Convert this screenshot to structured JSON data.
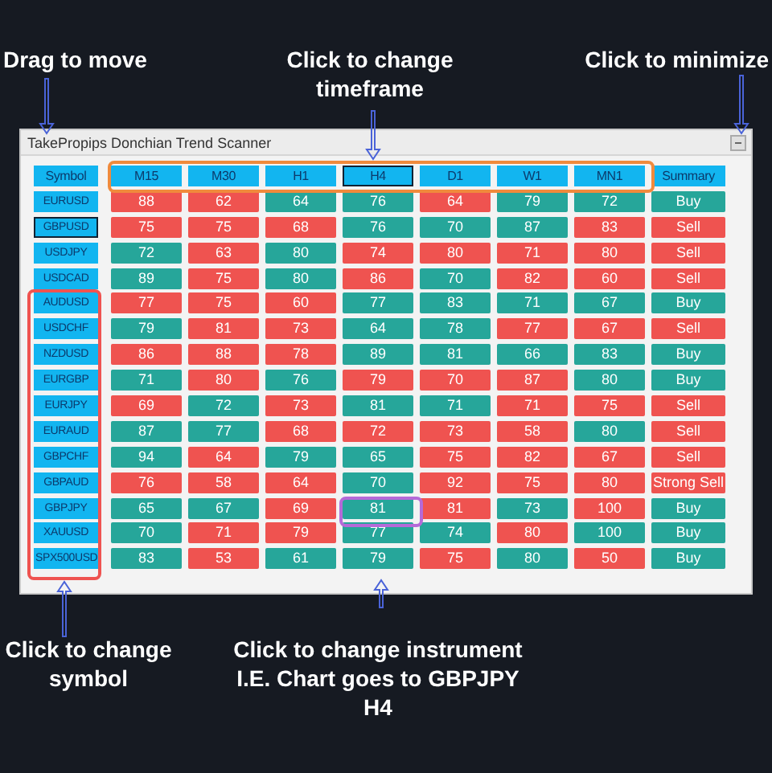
{
  "annotations": {
    "top": [
      {
        "text": "Drag to move"
      },
      {
        "text": "Click to change timeframe"
      },
      {
        "text": "Click to minimize"
      }
    ],
    "bottom": [
      {
        "text": "Click to change symbol"
      },
      {
        "text": "Click to change instrument I.E. Chart goes to GBPJPY H4"
      }
    ]
  },
  "window": {
    "title": "TakePropips Donchian Trend Scanner"
  },
  "table": {
    "columns": [
      {
        "label": "Symbol",
        "selected": false
      },
      {
        "label": "M15",
        "selected": false
      },
      {
        "label": "M30",
        "selected": false
      },
      {
        "label": "H1",
        "selected": false
      },
      {
        "label": "H4",
        "selected": true
      },
      {
        "label": "D1",
        "selected": false
      },
      {
        "label": "W1",
        "selected": false
      },
      {
        "label": "MN1",
        "selected": false
      },
      {
        "label": "Summary",
        "selected": false
      }
    ],
    "rows": [
      {
        "selected": false,
        "cells": [
          {
            "text": "EURUSD"
          },
          {
            "text": "88",
            "color": "#ef5350"
          },
          {
            "text": "62",
            "color": "#ef5350"
          },
          {
            "text": "64",
            "color": "#26a69a"
          },
          {
            "text": "76",
            "color": "#26a69a"
          },
          {
            "text": "64",
            "color": "#ef5350"
          },
          {
            "text": "79",
            "color": "#26a69a"
          },
          {
            "text": "72",
            "color": "#26a69a"
          },
          {
            "text": "Buy",
            "color": "#26a69a"
          }
        ]
      },
      {
        "selected": true,
        "cells": [
          {
            "text": "GBPUSD"
          },
          {
            "text": "75",
            "color": "#ef5350"
          },
          {
            "text": "75",
            "color": "#ef5350"
          },
          {
            "text": "68",
            "color": "#ef5350"
          },
          {
            "text": "76",
            "color": "#26a69a"
          },
          {
            "text": "70",
            "color": "#26a69a"
          },
          {
            "text": "87",
            "color": "#26a69a"
          },
          {
            "text": "83",
            "color": "#ef5350"
          },
          {
            "text": "Sell",
            "color": "#ef5350"
          }
        ]
      },
      {
        "selected": false,
        "cells": [
          {
            "text": "USDJPY"
          },
          {
            "text": "72",
            "color": "#26a69a"
          },
          {
            "text": "63",
            "color": "#ef5350"
          },
          {
            "text": "80",
            "color": "#26a69a"
          },
          {
            "text": "74",
            "color": "#ef5350"
          },
          {
            "text": "80",
            "color": "#ef5350"
          },
          {
            "text": "71",
            "color": "#ef5350"
          },
          {
            "text": "80",
            "color": "#ef5350"
          },
          {
            "text": "Sell",
            "color": "#ef5350"
          }
        ]
      },
      {
        "selected": false,
        "cells": [
          {
            "text": "USDCAD"
          },
          {
            "text": "89",
            "color": "#26a69a"
          },
          {
            "text": "75",
            "color": "#ef5350"
          },
          {
            "text": "80",
            "color": "#26a69a"
          },
          {
            "text": "86",
            "color": "#ef5350"
          },
          {
            "text": "70",
            "color": "#26a69a"
          },
          {
            "text": "82",
            "color": "#ef5350"
          },
          {
            "text": "60",
            "color": "#ef5350"
          },
          {
            "text": "Sell",
            "color": "#ef5350"
          }
        ]
      },
      {
        "selected": false,
        "cells": [
          {
            "text": "AUDUSD"
          },
          {
            "text": "77",
            "color": "#ef5350"
          },
          {
            "text": "75",
            "color": "#ef5350"
          },
          {
            "text": "60",
            "color": "#ef5350"
          },
          {
            "text": "77",
            "color": "#26a69a"
          },
          {
            "text": "83",
            "color": "#26a69a"
          },
          {
            "text": "71",
            "color": "#26a69a"
          },
          {
            "text": "67",
            "color": "#26a69a"
          },
          {
            "text": "Buy",
            "color": "#26a69a"
          }
        ]
      },
      {
        "selected": false,
        "cells": [
          {
            "text": "USDCHF"
          },
          {
            "text": "79",
            "color": "#26a69a"
          },
          {
            "text": "81",
            "color": "#ef5350"
          },
          {
            "text": "73",
            "color": "#ef5350"
          },
          {
            "text": "64",
            "color": "#26a69a"
          },
          {
            "text": "78",
            "color": "#26a69a"
          },
          {
            "text": "77",
            "color": "#ef5350"
          },
          {
            "text": "67",
            "color": "#ef5350"
          },
          {
            "text": "Sell",
            "color": "#ef5350"
          }
        ]
      },
      {
        "selected": false,
        "cells": [
          {
            "text": "NZDUSD"
          },
          {
            "text": "86",
            "color": "#ef5350"
          },
          {
            "text": "88",
            "color": "#ef5350"
          },
          {
            "text": "78",
            "color": "#ef5350"
          },
          {
            "text": "89",
            "color": "#26a69a"
          },
          {
            "text": "81",
            "color": "#26a69a"
          },
          {
            "text": "66",
            "color": "#26a69a"
          },
          {
            "text": "83",
            "color": "#26a69a"
          },
          {
            "text": "Buy",
            "color": "#26a69a"
          }
        ]
      },
      {
        "selected": false,
        "cells": [
          {
            "text": "EURGBP"
          },
          {
            "text": "71",
            "color": "#26a69a"
          },
          {
            "text": "80",
            "color": "#ef5350"
          },
          {
            "text": "76",
            "color": "#26a69a"
          },
          {
            "text": "79",
            "color": "#ef5350"
          },
          {
            "text": "70",
            "color": "#ef5350"
          },
          {
            "text": "87",
            "color": "#ef5350"
          },
          {
            "text": "80",
            "color": "#26a69a"
          },
          {
            "text": "Buy",
            "color": "#26a69a"
          }
        ]
      },
      {
        "selected": false,
        "cells": [
          {
            "text": "EURJPY"
          },
          {
            "text": "69",
            "color": "#ef5350"
          },
          {
            "text": "72",
            "color": "#26a69a"
          },
          {
            "text": "73",
            "color": "#ef5350"
          },
          {
            "text": "81",
            "color": "#26a69a"
          },
          {
            "text": "71",
            "color": "#26a69a"
          },
          {
            "text": "71",
            "color": "#ef5350"
          },
          {
            "text": "75",
            "color": "#ef5350"
          },
          {
            "text": "Sell",
            "color": "#ef5350"
          }
        ]
      },
      {
        "selected": false,
        "cells": [
          {
            "text": "EURAUD"
          },
          {
            "text": "87",
            "color": "#26a69a"
          },
          {
            "text": "77",
            "color": "#26a69a"
          },
          {
            "text": "68",
            "color": "#ef5350"
          },
          {
            "text": "72",
            "color": "#ef5350"
          },
          {
            "text": "73",
            "color": "#ef5350"
          },
          {
            "text": "58",
            "color": "#ef5350"
          },
          {
            "text": "80",
            "color": "#26a69a"
          },
          {
            "text": "Sell",
            "color": "#ef5350"
          }
        ]
      },
      {
        "selected": false,
        "cells": [
          {
            "text": "GBPCHF"
          },
          {
            "text": "94",
            "color": "#26a69a"
          },
          {
            "text": "64",
            "color": "#ef5350"
          },
          {
            "text": "79",
            "color": "#26a69a"
          },
          {
            "text": "65",
            "color": "#26a69a"
          },
          {
            "text": "75",
            "color": "#ef5350"
          },
          {
            "text": "82",
            "color": "#ef5350"
          },
          {
            "text": "67",
            "color": "#ef5350"
          },
          {
            "text": "Sell",
            "color": "#ef5350"
          }
        ]
      },
      {
        "selected": false,
        "cells": [
          {
            "text": "GBPAUD"
          },
          {
            "text": "76",
            "color": "#ef5350"
          },
          {
            "text": "58",
            "color": "#ef5350"
          },
          {
            "text": "64",
            "color": "#ef5350"
          },
          {
            "text": "70",
            "color": "#26a69a"
          },
          {
            "text": "92",
            "color": "#ef5350"
          },
          {
            "text": "75",
            "color": "#ef5350"
          },
          {
            "text": "80",
            "color": "#ef5350"
          },
          {
            "text": "Strong Sell",
            "color": "#ef5350"
          }
        ]
      },
      {
        "selected": false,
        "cells": [
          {
            "text": "GBPJPY"
          },
          {
            "text": "65",
            "color": "#26a69a"
          },
          {
            "text": "67",
            "color": "#26a69a"
          },
          {
            "text": "69",
            "color": "#ef5350"
          },
          {
            "text": "81",
            "color": "#26a69a"
          },
          {
            "text": "81",
            "color": "#ef5350"
          },
          {
            "text": "73",
            "color": "#26a69a"
          },
          {
            "text": "100",
            "color": "#ef5350"
          },
          {
            "text": "Buy",
            "color": "#26a69a"
          }
        ]
      },
      {
        "selected": false,
        "cells": [
          {
            "text": "XAUUSD"
          },
          {
            "text": "70",
            "color": "#26a69a"
          },
          {
            "text": "71",
            "color": "#ef5350"
          },
          {
            "text": "79",
            "color": "#ef5350"
          },
          {
            "text": "77",
            "color": "#26a69a"
          },
          {
            "text": "74",
            "color": "#26a69a"
          },
          {
            "text": "80",
            "color": "#ef5350"
          },
          {
            "text": "100",
            "color": "#26a69a"
          },
          {
            "text": "Buy",
            "color": "#26a69a"
          }
        ]
      },
      {
        "selected": false,
        "cells": [
          {
            "text": "SPX500USD"
          },
          {
            "text": "83",
            "color": "#26a69a"
          },
          {
            "text": "53",
            "color": "#ef5350"
          },
          {
            "text": "61",
            "color": "#26a69a"
          },
          {
            "text": "79",
            "color": "#26a69a"
          },
          {
            "text": "75",
            "color": "#ef5350"
          },
          {
            "text": "80",
            "color": "#26a69a"
          },
          {
            "text": "50",
            "color": "#ef5350"
          },
          {
            "text": "Buy",
            "color": "#26a69a"
          }
        ]
      }
    ]
  }
}
